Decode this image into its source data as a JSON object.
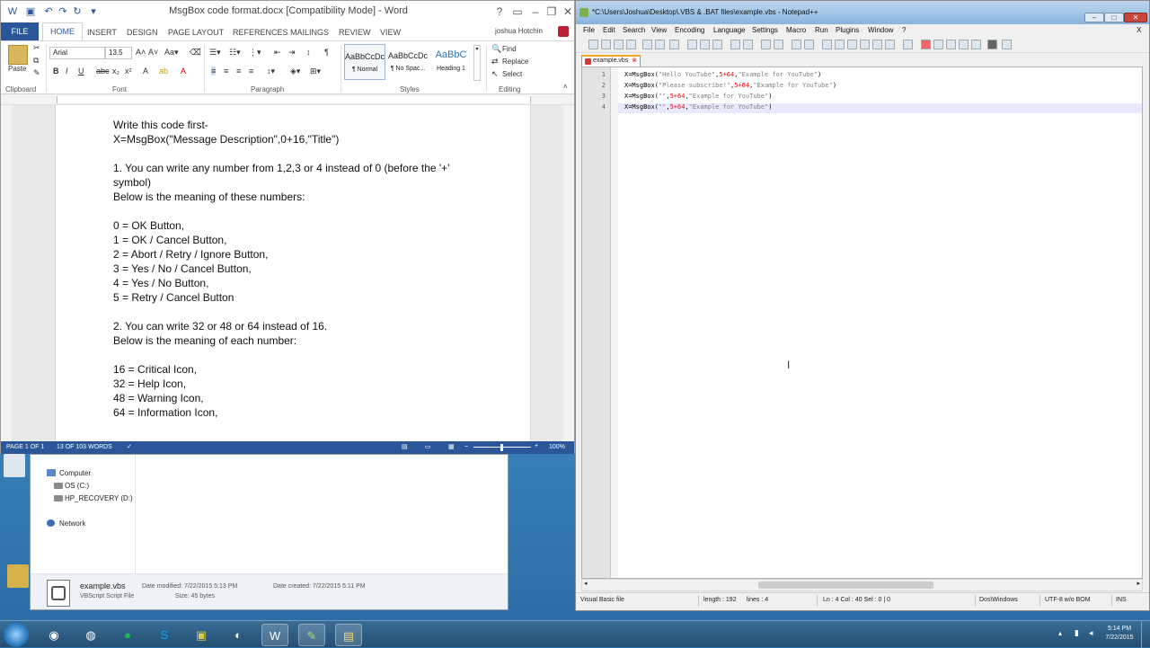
{
  "word": {
    "title": "MsgBox code format.docx [Compatibility Mode] - Word",
    "user": "joshua Hotchin",
    "tabs": [
      "FILE",
      "HOME",
      "INSERT",
      "DESIGN",
      "PAGE LAYOUT",
      "REFERENCES",
      "MAILINGS",
      "REVIEW",
      "VIEW"
    ],
    "ribbon": {
      "paste": "Paste",
      "font_name": "Arial",
      "font_size": "13.5",
      "styles": [
        {
          "sample": "AaBbCcDc",
          "name": "¶ Normal"
        },
        {
          "sample": "AaBbCcDc",
          "name": "¶ No Spac..."
        },
        {
          "sample": "AaBbC",
          "name": "Heading 1"
        }
      ],
      "find": "Find",
      "replace": "Replace",
      "select": "Select",
      "groups": [
        "Clipboard",
        "Font",
        "Paragraph",
        "Styles",
        "Editing"
      ]
    },
    "document_lines": [
      "Write this code first-",
      "X=MsgBox(\"Message Description\",0+16,\"Title\")",
      "",
      "1. You can write any number from 1,2,3 or 4 instead of 0 (before the '+'",
      "symbol)",
      "Below is the meaning of these numbers:",
      "",
      "0 = OK Button,",
      "1 = OK / Cancel Button,",
      "2 = Abort / Retry / Ignore Button,",
      "3 = Yes / No / Cancel Button,",
      "4 = Yes / No Button,",
      "5 = Retry / Cancel Button",
      "",
      "2. You can write 32 or 48 or 64 instead of 16.",
      "Below is the meaning of each number:",
      "",
      "16 = Critical Icon,",
      "32 = Help Icon,",
      "48 = Warning Icon,",
      "64 = Information Icon,"
    ],
    "status": {
      "page": "PAGE 1 OF 1",
      "words": "13 OF 103 WORDS",
      "zoom": "100%"
    }
  },
  "explorer": {
    "nav": [
      "Computer",
      "OS (C:)",
      "HP_RECOVERY (D:)",
      "Network"
    ],
    "file": {
      "name": "example.vbs",
      "type": "VBScript Script File",
      "modified_label": "Date modified: 7/22/2015 5:13 PM",
      "created_label": "Date created: 7/22/2015 5:11 PM",
      "size_label": "Size: 45 bytes"
    }
  },
  "npp": {
    "title": "*C:\\Users\\Joshua\\Desktop\\.VBS & .BAT files\\example.vbs - Notepad++",
    "menu": [
      "File",
      "Edit",
      "Search",
      "View",
      "Encoding",
      "Language",
      "Settings",
      "Macro",
      "Run",
      "Plugins",
      "Window",
      "?"
    ],
    "tab": "example.vbs",
    "lines": [
      {
        "n": "1",
        "pre": "X=MsgBox(",
        "s1": "\"Hello YouTube\"",
        "mid": ",",
        "num": "5+64",
        "post": ",",
        "s2": "\"Example for YouTube\"",
        "end": ")"
      },
      {
        "n": "2",
        "pre": "X=MsgBox(",
        "s1": "\"Please subscribe!\"",
        "mid": ",",
        "num": "5+64",
        "post": ",",
        "s2": "\"Example for YouTube\"",
        "end": ")"
      },
      {
        "n": "3",
        "pre": "X=MsgBox(",
        "s1": "\"\"",
        "mid": ",",
        "num": "5+64",
        "post": ",",
        "s2": "\"Example for YouTube\"",
        "end": ")"
      },
      {
        "n": "4",
        "pre": "X=MsgBox(",
        "s1": "\"\"",
        "mid": ",",
        "num": "5+64",
        "post": ",",
        "s2": "\"Example for YouTube\"",
        "end": ")"
      }
    ],
    "status": {
      "type": "Visual Basic file",
      "length": "length : 192",
      "lines": "lines : 4",
      "pos": "Ln : 4    Col : 40    Sel : 0 | 0",
      "eol": "Dos\\Windows",
      "encoding": "UTF-8 w/o BOM",
      "mode": "INS"
    }
  },
  "taskbar": {
    "time": "5:14 PM",
    "date": "7/22/2015"
  }
}
